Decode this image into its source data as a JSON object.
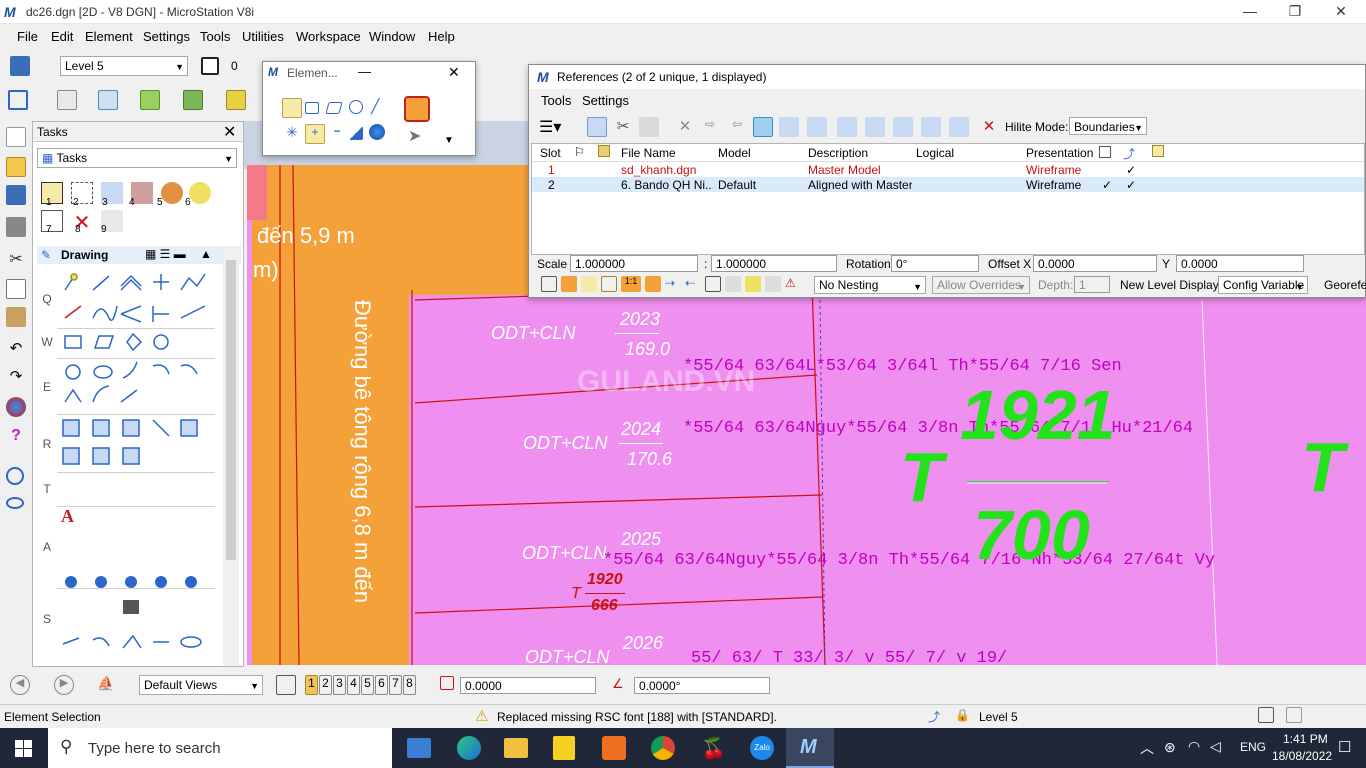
{
  "window": {
    "title": "dc26.dgn [2D - V8 DGN] - MicroStation V8i",
    "app_icon": "microstation-icon",
    "min": "—",
    "max": "❐",
    "close": "✕"
  },
  "menu": [
    "File",
    "Edit",
    "Element",
    "Settings",
    "Tools",
    "Utilities",
    "Workspace",
    "Window",
    "Help"
  ],
  "attributes": {
    "level": "Level 5",
    "color": "0"
  },
  "tasks": {
    "title": "Tasks",
    "combo": "Tasks",
    "group": "Drawing",
    "side_letters": [
      "Q",
      "W",
      "E",
      "R",
      "T",
      "A",
      "S"
    ],
    "tool_numbers": [
      "1",
      "2",
      "3",
      "4",
      "5",
      "6",
      "7",
      "8",
      "9"
    ]
  },
  "element_dialog": {
    "title": "Elemen..."
  },
  "references": {
    "title": "References (2 of 2 unique, 1 displayed)",
    "menu": [
      "Tools",
      "Settings"
    ],
    "hilite_label": "Hilite Mode:",
    "hilite_value": "Boundaries",
    "columns": [
      "Slot",
      "File Name",
      "Model",
      "Description",
      "Logical",
      "Presentation"
    ],
    "rows": [
      {
        "slot": "1",
        "file": "sd_khanh.dgn",
        "model": "",
        "description": "Master Model",
        "logical": "",
        "presentation": "Wireframe",
        "c1": "",
        "c2": "✓"
      },
      {
        "slot": "2",
        "file": "6. Bando QH Ni...",
        "model": "Default",
        "description": "Aligned with Master...",
        "logical": "",
        "presentation": "Wireframe",
        "c1": "✓",
        "c2": "✓"
      }
    ],
    "scale_label": "Scale",
    "scale1": "1.000000",
    "scale_sep": ":",
    "scale2": "1.000000",
    "rotation_label": "Rotation",
    "rotation": "0°",
    "offset_label": "Offset X",
    "offset_x": "0.0000",
    "y_label": "Y",
    "offset_y": "0.0000",
    "nesting": "No Nesting",
    "overrides": "Allow Overrides",
    "depth_label": "Depth:",
    "depth": "1",
    "new_level_label": "New Level Display:",
    "new_level": "Config Variable",
    "georef": "Georefer"
  },
  "drawing": {
    "road_text": "Đường bê tông rộng 6,8 m đến",
    "road_text2a": "đến 5,9 m",
    "road_text2b": "m)",
    "watermark": "GULAND.VN",
    "parcels": [
      {
        "label": "ODT+CLN",
        "num": "2023",
        "area": "169.0",
        "owners": "*55/64 63/64L*53/64 3/64l Th*55/64 7/16  Sen"
      },
      {
        "label": "ODT+CLN",
        "num": "2024",
        "area": "170.6",
        "owners": "*55/64 63/64Nguy*55/64 3/8n  Th*55/64 7/16  Hu*21/64"
      },
      {
        "label": "ODT+CLN",
        "num": "2025",
        "area": "",
        "owners": "*55/64 63/64Nguy*55/64 3/8n  Th*55/64 7/16  Nh*53/64 27/64t Vy"
      },
      {
        "label": "ODT+CLN",
        "num": "2026",
        "area": "",
        "owners": "55/  63/  T   33/  3/   v   55/  7/   v  19/"
      }
    ],
    "big_t": "T",
    "big_num": "1921",
    "big_area": "700",
    "big_t2": "T",
    "small_t": "T",
    "small_num": "1920",
    "small_area": "666"
  },
  "view_bar": {
    "views": "Default Views",
    "view_nums": [
      "1",
      "2",
      "3",
      "4",
      "5",
      "6",
      "7",
      "8"
    ],
    "dist": "0.0000",
    "angle": "0.0000°"
  },
  "status": {
    "left": "Element Selection",
    "message": "Replaced missing RSC font [188] with [STANDARD].",
    "level": "Level 5"
  },
  "taskbar": {
    "search": "Type here to search",
    "lang": "ENG",
    "time": "1:41 PM",
    "date": "18/08/2022"
  },
  "colors": {
    "pink": "#ef8ff0",
    "road": "#f4a13a",
    "green": "#22e31a",
    "magenta": "#c000c0",
    "red": "#cc1010"
  }
}
